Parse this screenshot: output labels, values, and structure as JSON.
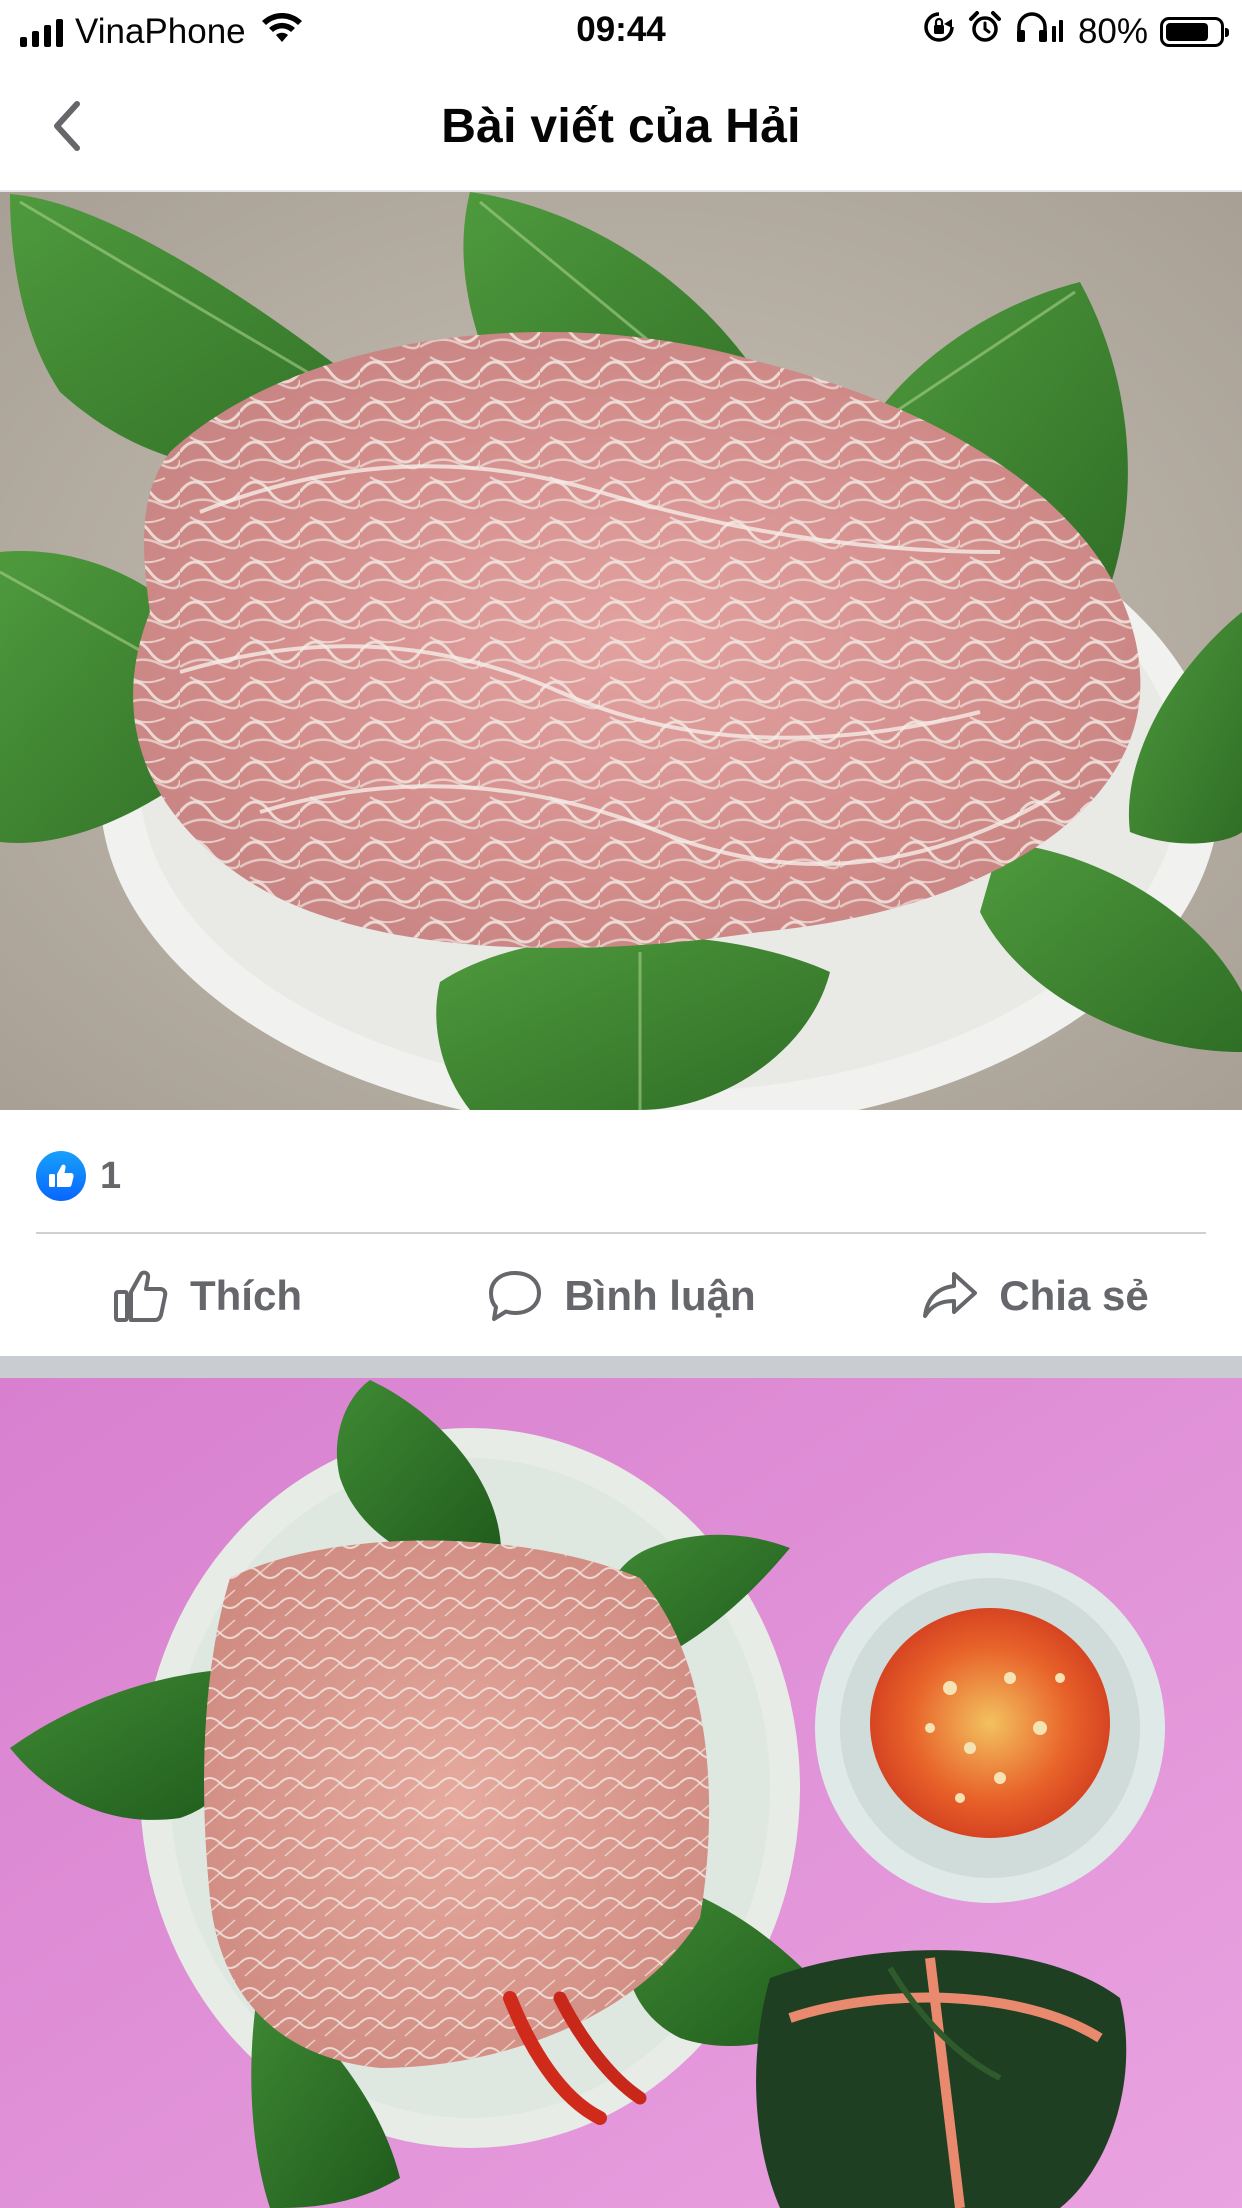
{
  "status_bar": {
    "carrier": "VinaPhone",
    "time": "09:44",
    "battery": "80%",
    "battery_level": 0.8,
    "icons": [
      "signal-icon",
      "wifi-icon",
      "rotation-lock-icon",
      "alarm-icon",
      "headphones-icon",
      "battery-icon"
    ]
  },
  "header": {
    "title": "Bài viết của Hải",
    "back_icon": "chevron-left-icon"
  },
  "post1": {
    "image": "photo of raw pork and pork skin on leaves on a plate",
    "reactions": {
      "icon": "like-icon",
      "count": "1"
    },
    "actions": [
      {
        "label": "Thích",
        "icon": "thumbs-up-icon"
      },
      {
        "label": "Bình luận",
        "icon": "comment-icon"
      },
      {
        "label": "Chia sẻ",
        "icon": "share-icon"
      }
    ]
  },
  "post2": {
    "image": "photo of pork dish on leaves with dipping sauce and wrapped rice cake on pink background"
  },
  "colors": {
    "accent": "#0866ff",
    "action_text": "#65676b",
    "divider": "#ced0d4",
    "separator": "#c9ccd1"
  }
}
